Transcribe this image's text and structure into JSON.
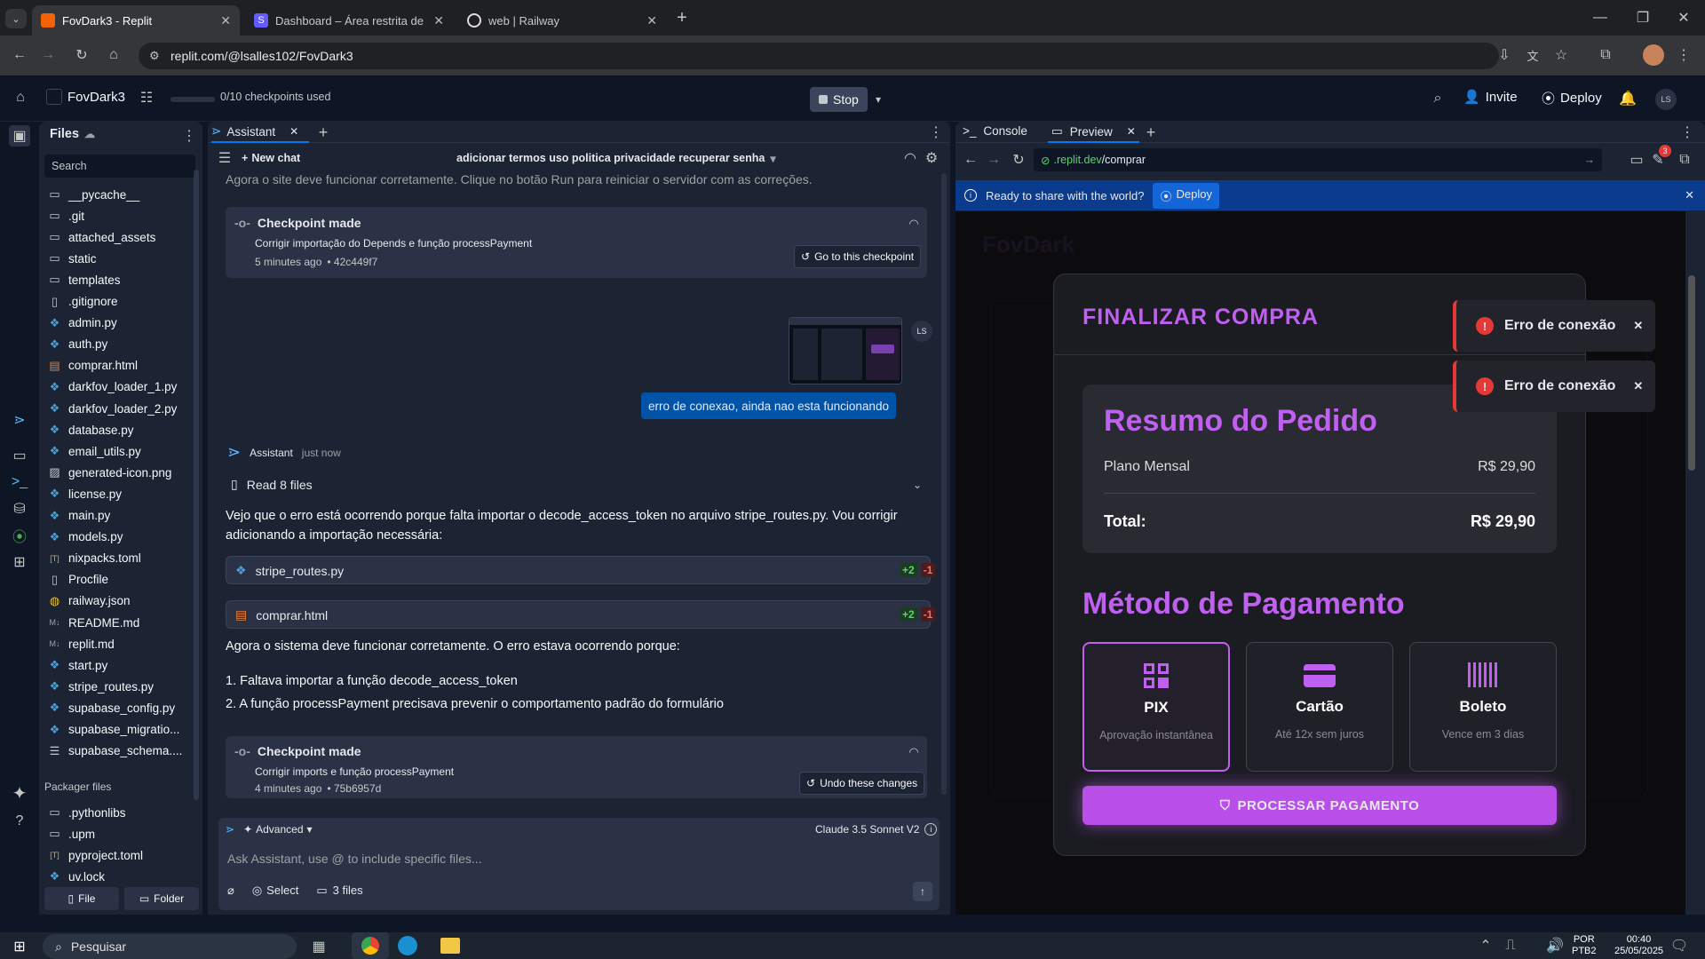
{
  "browser": {
    "tabs": [
      {
        "title": "FovDark3 - Replit"
      },
      {
        "title": "Dashboard – Área restrita de Fo"
      },
      {
        "title": "web | Railway"
      }
    ],
    "url": "replit.com/@lsalles102/FovDark3"
  },
  "replit": {
    "project": "FovDark3",
    "checkpoints": "0/10 checkpoints used",
    "stop": "Stop",
    "invite": "Invite",
    "deploy": "Deploy",
    "avatar": "LS"
  },
  "files_panel": {
    "title": "Files",
    "search": "Search",
    "items": [
      {
        "name": "__pycache__",
        "icon": "folder-icon"
      },
      {
        "name": ".git",
        "icon": "folder-icon"
      },
      {
        "name": "attached_assets",
        "icon": "folder-icon"
      },
      {
        "name": "static",
        "icon": "folder-icon"
      },
      {
        "name": "templates",
        "icon": "folder-icon"
      },
      {
        "name": ".gitignore",
        "icon": "file-icon"
      },
      {
        "name": "admin.py",
        "icon": "python-icon"
      },
      {
        "name": "auth.py",
        "icon": "python-icon"
      },
      {
        "name": "comprar.html",
        "icon": "html-icon"
      },
      {
        "name": "darkfov_loader_1.py",
        "icon": "python-icon"
      },
      {
        "name": "darkfov_loader_2.py",
        "icon": "python-icon"
      },
      {
        "name": "database.py",
        "icon": "python-icon"
      },
      {
        "name": "email_utils.py",
        "icon": "python-icon"
      },
      {
        "name": "generated-icon.png",
        "icon": "image-icon"
      },
      {
        "name": "license.py",
        "icon": "python-icon"
      },
      {
        "name": "main.py",
        "icon": "python-icon"
      },
      {
        "name": "models.py",
        "icon": "python-icon"
      },
      {
        "name": "nixpacks.toml",
        "icon": "toml-icon"
      },
      {
        "name": "Procfile",
        "icon": "file-icon"
      },
      {
        "name": "railway.json",
        "icon": "json-icon"
      },
      {
        "name": "README.md",
        "icon": "md-icon"
      },
      {
        "name": "replit.md",
        "icon": "md-icon"
      },
      {
        "name": "start.py",
        "icon": "python-icon"
      },
      {
        "name": "stripe_routes.py",
        "icon": "python-icon"
      },
      {
        "name": "supabase_config.py",
        "icon": "python-icon"
      },
      {
        "name": "supabase_migratio...",
        "icon": "python-icon"
      },
      {
        "name": "supabase_schema....",
        "icon": "db-icon"
      }
    ],
    "packager_title": "Packager files",
    "packager": [
      {
        "name": ".pythonlibs",
        "icon": "folder-icon"
      },
      {
        "name": ".upm",
        "icon": "folder-icon"
      },
      {
        "name": "pyproject.toml",
        "icon": "toml-icon"
      },
      {
        "name": "uv.lock",
        "icon": "python-icon"
      }
    ],
    "file_btn": "File",
    "folder_btn": "Folder"
  },
  "assistant": {
    "tab": "Assistant",
    "new_chat": "New chat",
    "chat_title": "adicionar termos uso politica privacidade recuperar senha",
    "top_text": "Agora o site deve funcionar corretamente. Clique no botão Run para reiniciar o servidor com as correções.",
    "checkpoint1": {
      "title": "Checkpoint made",
      "desc": "Corrigir importação do Depends e função processPayment",
      "time": "5 minutes ago",
      "hash": "• 42c449f7",
      "btn": "Go to this checkpoint"
    },
    "user_msg": "erro de conexao, ainda nao esta funcionando",
    "user_avatar": "LS",
    "assistant_name": "Assistant",
    "assistant_time": "just now",
    "read_files": "Read 8 files",
    "para1": "Vejo que o erro está ocorrendo porque falta importar o decode_access_token no arquivo stripe_routes.py. Vou corrigir adicionando a importação necessária:",
    "file1": {
      "name": "stripe_routes.py",
      "add": "+2",
      "del": "-1"
    },
    "file2": {
      "name": "comprar.html",
      "add": "+2",
      "del": "-1"
    },
    "para2": "Agora o sistema deve funcionar corretamente. O erro estava ocorrendo porque:",
    "list1": "1. Faltava importar a função decode_access_token",
    "list2": "2. A função processPayment precisava prevenir o comportamento padrão do formulário",
    "checkpoint2": {
      "title": "Checkpoint made",
      "desc": "Corrigir imports e função processPayment",
      "time": "4 minutes ago",
      "hash": "• 75b6957d",
      "btn": "Undo these changes"
    },
    "advanced": "Advanced",
    "model": "Claude 3.5 Sonnet V2",
    "input_placeholder": "Ask Assistant, use @ to include specific files...",
    "select": "Select",
    "files_count": "3 files"
  },
  "right_panel": {
    "tab_console": "Console",
    "tab_preview": "Preview",
    "url_host": ".replit.dev",
    "url_path": "/comprar",
    "badge": "3",
    "banner_text": "Ready to share with the world?",
    "banner_btn": "Deploy"
  },
  "checkout": {
    "bg_logo": "FovDark",
    "title": "FINALIZAR COMPRA",
    "summary_title": "Resumo do Pedido",
    "plan": "Plano Mensal",
    "plan_price": "R$ 29,90",
    "total_label": "Total:",
    "total_value": "R$ 29,90",
    "method_title": "Método de Pagamento",
    "methods": [
      {
        "name": "PIX",
        "desc": "Aprovação instantânea"
      },
      {
        "name": "Cartão",
        "desc": "Até 12x sem juros"
      },
      {
        "name": "Boleto",
        "desc": "Vence em 3 dias"
      }
    ],
    "process_btn": "PROCESSAR PAGAMENTO",
    "toast1": "Erro de conexão",
    "toast2": "Erro de conexão"
  },
  "taskbar": {
    "search": "Pesquisar",
    "lang1": "POR",
    "lang2": "PTB2",
    "time": "00:40",
    "date": "25/05/2025"
  },
  "colors": {
    "accent_purple": "#c060f0",
    "replit_bg": "#0e1525",
    "panel_bg": "#1c2333",
    "error_red": "#e53935",
    "banner_blue": "#0d47a1"
  }
}
